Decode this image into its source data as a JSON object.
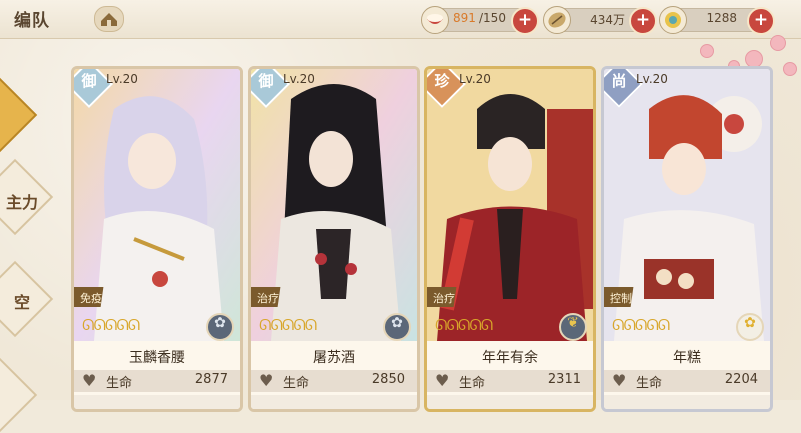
{
  "header": {
    "title": "编队",
    "resources": [
      {
        "icon": "rice-bowl-icon",
        "current": "891",
        "max": "/150"
      },
      {
        "icon": "coin-icon",
        "value": "434万"
      },
      {
        "icon": "gem-icon",
        "value": "1288"
      }
    ]
  },
  "side_tabs": [
    {
      "label": "",
      "active": true
    },
    {
      "label": "主力",
      "active": false
    },
    {
      "label": "空",
      "active": false
    },
    {
      "label": "",
      "active": false
    }
  ],
  "cards": [
    {
      "rank": "御",
      "level": "Lv.20",
      "role": "免疫",
      "name": "玉麟香腰",
      "stat_label": "生命",
      "stat_value": "2877",
      "stars": "ᘏᘏᘏᘏᘏ"
    },
    {
      "rank": "御",
      "level": "Lv.20",
      "role": "治疗",
      "name": "屠苏酒",
      "stat_label": "生命",
      "stat_value": "2850",
      "stars": "ᘏᘏᘏᘏᘏ"
    },
    {
      "rank": "珍",
      "level": "Lv.20",
      "role": "治疗",
      "name": "年年有余",
      "stat_label": "生命",
      "stat_value": "2311",
      "stars": "ᘏᘏᘏᘏᘏ"
    },
    {
      "rank": "尚",
      "level": "Lv.20",
      "role": "控制",
      "name": "年糕",
      "stat_label": "生命",
      "stat_value": "2204",
      "stars": "ᘏᘏᘏᘏᘏ"
    }
  ],
  "colors": {
    "accent_red": "#c8473e",
    "gold": "#d8a62a"
  }
}
